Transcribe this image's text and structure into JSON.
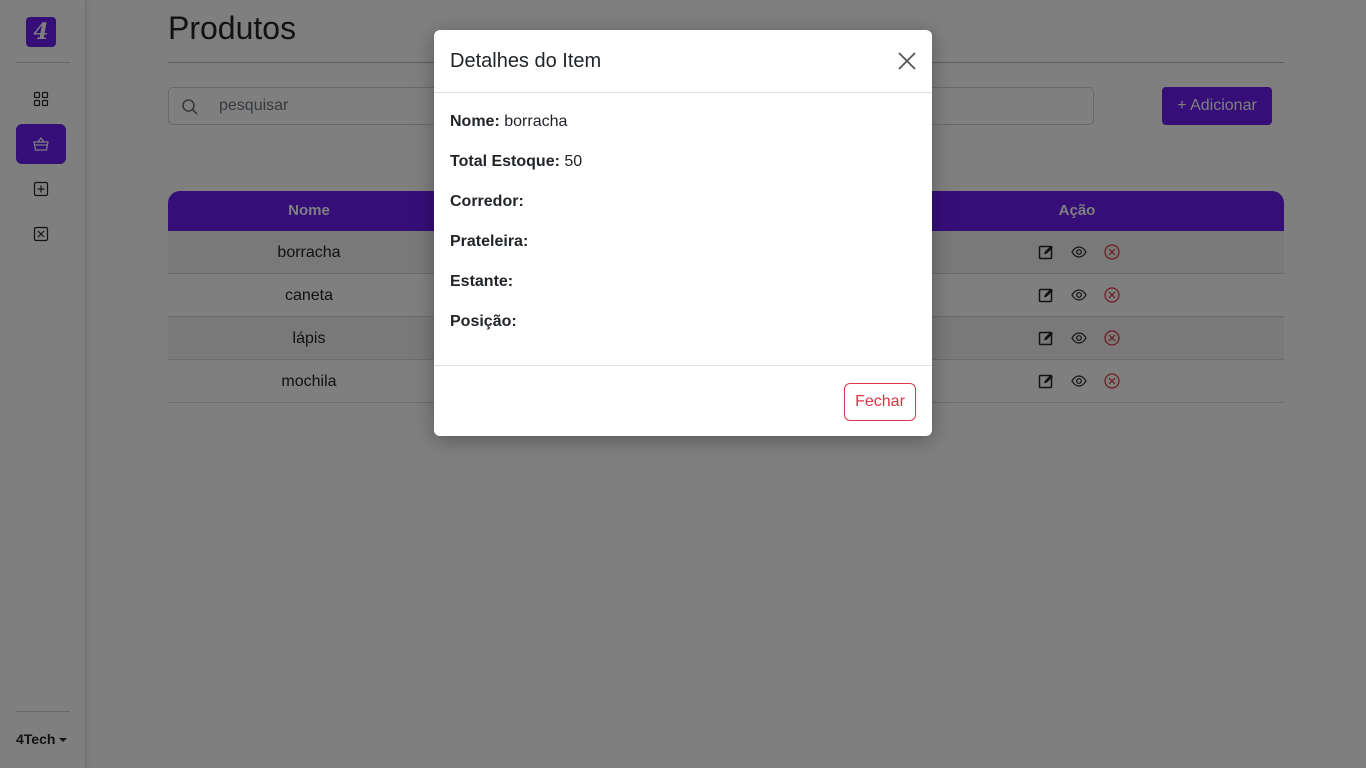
{
  "sidebar": {
    "logo": "4",
    "nav": [
      {
        "icon": "grid-icon",
        "active": false
      },
      {
        "icon": "basket-icon",
        "active": true
      },
      {
        "icon": "plus-square-icon",
        "active": false
      },
      {
        "icon": "x-square-icon",
        "active": false
      }
    ],
    "brand": "4Tech"
  },
  "main": {
    "title": "Produtos",
    "search": {
      "placeholder": "pesquisar",
      "value": ""
    },
    "add_button": "+ Adicionar",
    "table": {
      "headers": {
        "name": "Nome",
        "action": "Ação"
      },
      "rows": [
        {
          "name": "borracha"
        },
        {
          "name": "caneta"
        },
        {
          "name": "lápis"
        },
        {
          "name": "mochila"
        }
      ]
    }
  },
  "modal": {
    "title": "Detalhes do Item",
    "fields": [
      {
        "label": "Nome:",
        "value": "borracha"
      },
      {
        "label": "Total Estoque:",
        "value": "50"
      },
      {
        "label": "Corredor:",
        "value": ""
      },
      {
        "label": "Prateleira:",
        "value": ""
      },
      {
        "label": "Estante:",
        "value": ""
      },
      {
        "label": "Posição:",
        "value": ""
      }
    ],
    "close_label": "Fechar"
  },
  "colors": {
    "accent": "#6a1cf0",
    "danger": "#dc3545"
  }
}
